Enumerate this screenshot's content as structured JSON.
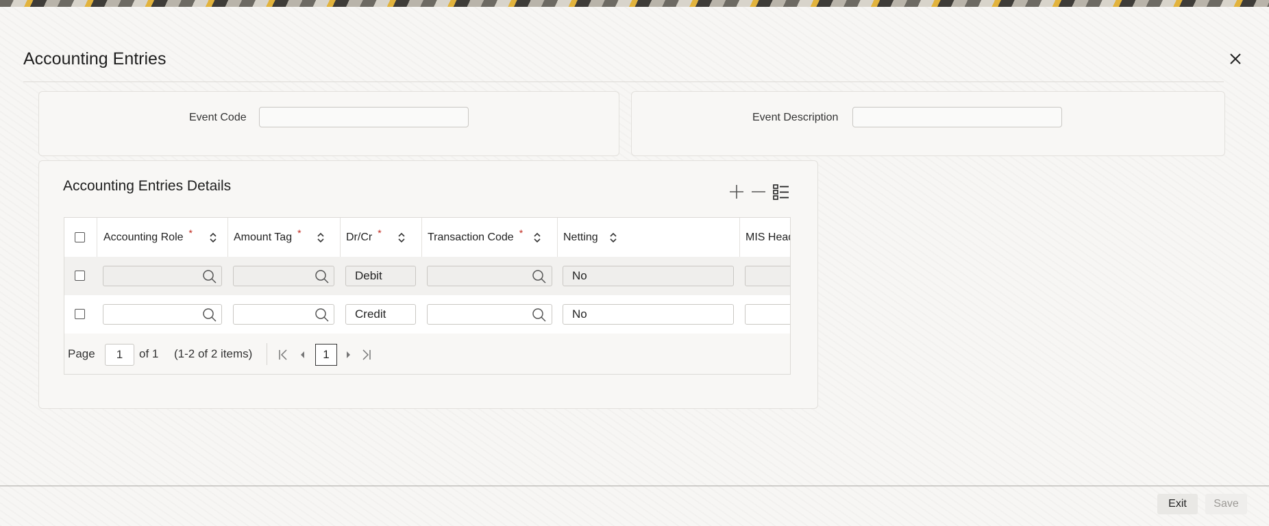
{
  "window": {
    "title": "Accounting Entries"
  },
  "header_form": {
    "event_code_label": "Event Code",
    "event_code_value": "",
    "event_description_label": "Event Description",
    "event_description_value": ""
  },
  "details": {
    "title": "Accounting Entries Details",
    "toolbar": {
      "add_icon": "plus-icon",
      "remove_icon": "minus-icon",
      "columns_icon": "list-settings-icon"
    },
    "columns": [
      {
        "label": "Accounting Role",
        "required": "*"
      },
      {
        "label": "Amount Tag",
        "required": "*"
      },
      {
        "label": "Dr/Cr",
        "required": "*"
      },
      {
        "label": "Transaction Code",
        "required": "*"
      },
      {
        "label": "Netting",
        "required": ""
      },
      {
        "label": "MIS Head",
        "required": ""
      }
    ],
    "rows": [
      {
        "accounting_role": "",
        "amount_tag": "",
        "dr_cr": "Debit",
        "transaction_code": "",
        "netting": "No",
        "mis_head": ""
      },
      {
        "accounting_role": "",
        "amount_tag": "",
        "dr_cr": "Credit",
        "transaction_code": "",
        "netting": "No",
        "mis_head": ""
      }
    ],
    "pagination": {
      "page_label": "Page",
      "page_value": "1",
      "of_text": "of 1",
      "items_text": "(1-2 of 2 items)",
      "current_page": "1"
    }
  },
  "footer": {
    "exit_label": "Exit",
    "save_label": "Save"
  },
  "colors": {
    "required": "#c0281d",
    "panel_bg": "#f8f7f5",
    "border": "#dcdad6"
  }
}
